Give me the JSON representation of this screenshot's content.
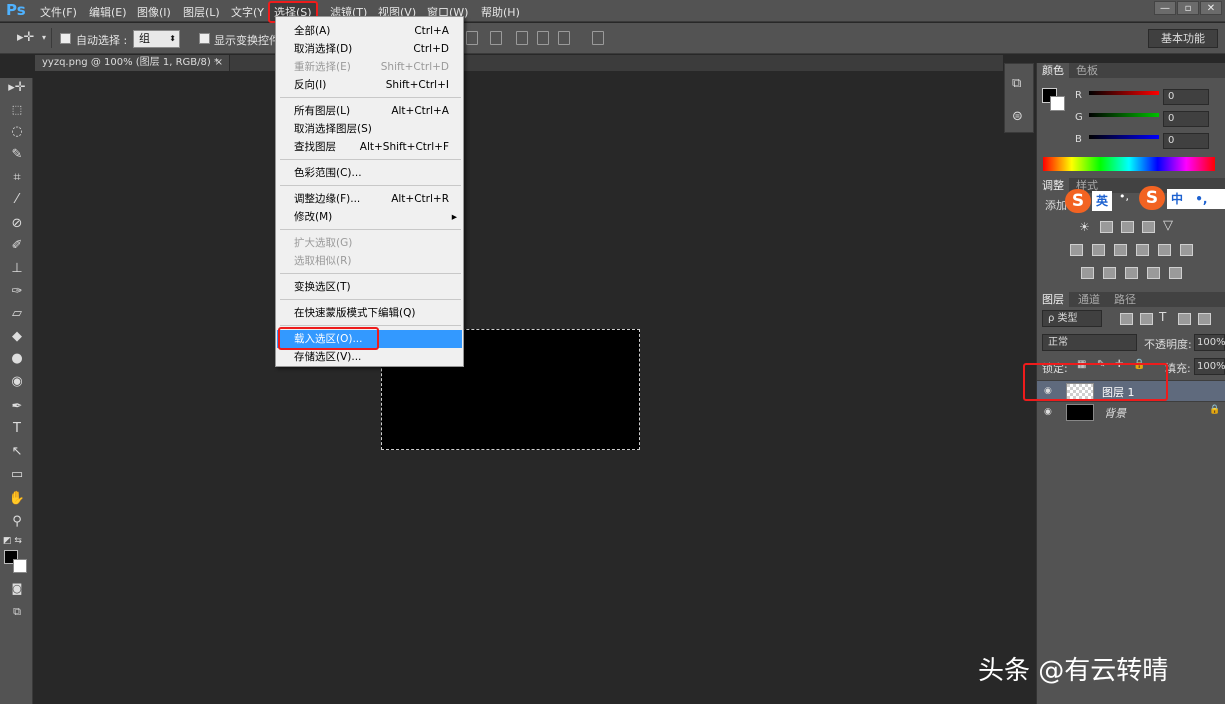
{
  "app": {
    "logo": "Ps"
  },
  "menubar": {
    "items": [
      {
        "label": "文件(F)"
      },
      {
        "label": "编辑(E)"
      },
      {
        "label": "图像(I)"
      },
      {
        "label": "图层(L)"
      },
      {
        "label": "文字(Y"
      },
      {
        "label": "选择(S)"
      },
      {
        "label": "滤镜(T)"
      },
      {
        "label": "视图(V)"
      },
      {
        "label": "窗口(W)"
      },
      {
        "label": "帮助(H)"
      }
    ],
    "window_controls": [
      "—",
      "▫",
      "✕"
    ]
  },
  "options_bar": {
    "auto_select_label": "自动选择 :",
    "group_value": "组",
    "show_transform_label": "显示变换控件",
    "workspace": "基本功能"
  },
  "document": {
    "tab_title": "yyzq.png @ 100% (图层 1, RGB/8) *",
    "tab_close": "×"
  },
  "select_menu": {
    "items": [
      {
        "label": "全部(A)",
        "shortcut": "Ctrl+A",
        "enabled": true
      },
      {
        "label": "取消选择(D)",
        "shortcut": "Ctrl+D",
        "enabled": true
      },
      {
        "label": "重新选择(E)",
        "shortcut": "Shift+Ctrl+D",
        "enabled": false
      },
      {
        "label": "反向(I)",
        "shortcut": "Shift+Ctrl+I",
        "enabled": true
      },
      {
        "label": "所有图层(L)",
        "shortcut": "Alt+Ctrl+A",
        "enabled": true
      },
      {
        "label": "取消选择图层(S)",
        "shortcut": "",
        "enabled": true
      },
      {
        "label": "查找图层",
        "shortcut": "Alt+Shift+Ctrl+F",
        "enabled": true
      },
      {
        "label": "色彩范围(C)...",
        "shortcut": "",
        "enabled": true
      },
      {
        "label": "调整边缘(F)...",
        "shortcut": "Alt+Ctrl+R",
        "enabled": true
      },
      {
        "label": "修改(M)",
        "shortcut": "▸",
        "enabled": true
      },
      {
        "label": "扩大选取(G)",
        "shortcut": "",
        "enabled": false
      },
      {
        "label": "选取相似(R)",
        "shortcut": "",
        "enabled": false
      },
      {
        "label": "变换选区(T)",
        "shortcut": "",
        "enabled": true
      },
      {
        "label": "在快速蒙版模式下编辑(Q)",
        "shortcut": "",
        "enabled": true
      },
      {
        "label": "载入选区(O)...",
        "shortcut": "",
        "enabled": true,
        "highlighted": true
      },
      {
        "label": "存储选区(V)...",
        "shortcut": "",
        "enabled": true
      }
    ]
  },
  "color_panel": {
    "tabs": [
      "颜色",
      "色板"
    ],
    "channels": [
      {
        "name": "R",
        "value": "0",
        "color": "#ff0000"
      },
      {
        "name": "G",
        "value": "0",
        "color": "#00c000"
      },
      {
        "name": "B",
        "value": "0",
        "color": "#0000ff"
      }
    ]
  },
  "adjustments_panel": {
    "tabs": [
      "调整",
      "样式"
    ],
    "add_label": "添加"
  },
  "ime": {
    "s": "S",
    "en": "英",
    "punct1": "•,",
    "s2": "S",
    "zh": "中",
    "punct2": "•,"
  },
  "layers_panel": {
    "tabs": [
      "图层",
      "通道",
      "路径"
    ],
    "filter_label": "ρ 类型",
    "blend_mode": "正常",
    "opacity_label": "不透明度:",
    "opacity_value": "100%",
    "lock_label": "锁定:",
    "fill_label": "填充:",
    "fill_value": "100%",
    "layers": [
      {
        "name": "图层 1",
        "selected": true,
        "eye": "👁"
      },
      {
        "name": "背景",
        "selected": false,
        "eye": "👁",
        "locked": true
      }
    ]
  },
  "watermark": "头条 @有云转晴"
}
